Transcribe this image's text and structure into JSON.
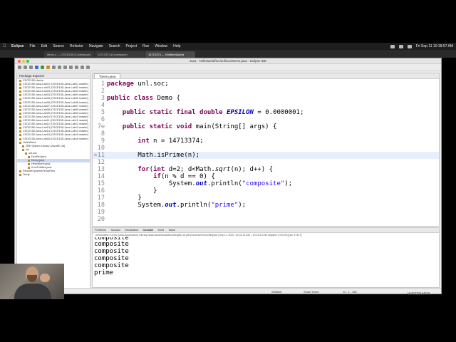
{
  "menubar": {
    "items": [
      "Eclipse",
      "File",
      "Edit",
      "Source",
      "Refactor",
      "Navigate",
      "Search",
      "Project",
      "Run",
      "Window",
      "Help"
    ],
    "clock": "Fri Sep 11 10:18:57 AM"
  },
  "browser_tabs": [
    "demo.c — CSCE155 (Codespace)",
    "14713374 (Codespace)",
    "14713374 — Wolfram|Alpha"
  ],
  "window": {
    "title": "Java - HelloWorld/src/unl/soc/Demo.java - Eclipse IDE"
  },
  "package_explorer": {
    "title": "Package Explorer",
    "items": [
      "CSCE155-Hacks",
      "CSCE155-Java-Lab01 [CSCE155-Java-Lab01 master]",
      "CSCE155-Java-Lab02 [CSCE155-Java-Lab02 master]",
      "CSCE155-Java-Lab03 [CSCE155-Java-Lab03 master]",
      "CSCE155-Java-Lab04 [CSCE155-Java-Lab04 master]",
      "CSCE155-Java-Lab05 [CSCE155-Java-Lab05 master]",
      "CSCE155-Java-Lab06 [CSCE155-Java-Lab06 master]",
      "CSCE155-Java-Lab07 [CSCE155-Java-Lab07 master]",
      "CSCE155-Java-Lab08 [CSCE155-Java-Lab08 master]",
      "CSCE155-Java-Lab09 [CSCE155-Java-Lab09 master]",
      "CSCE155-Java-Lab10 [CSCE155-Java-Lab10 master]",
      "CSCE155-Java-Lab11 [CSCE155-Java-Lab11 master]",
      "CSCE155-Java-Lab12 [CSCE155-Java-Lab12 master]",
      "CSCE155-Java-Lab13 [CSCE155-Java-Lab13 master]",
      "CSCE155-Java-Lab14 [CSCE155-Java-Lab14 master]",
      "CSCE155-Java-Lab15 [CSCE155-Java-Lab15 master]",
      "CSCE155-Java-Lab16 [CSCE155-Java-Lab16 master]",
      "HelloWorld",
      "JRE System Library [JavaSE-16]",
      "src",
      "unl.soc",
      "DecRef.java",
      "Demo.java",
      "HelloWorld.java",
      "KmsToMiles.java",
      "RemoteSystemsTempFiles",
      "Teisty"
    ],
    "selected_index": 22
  },
  "editor": {
    "tab": "*Demo.java",
    "lines": [
      {
        "n": "1",
        "tokens": [
          {
            "c": "kw",
            "t": "package"
          },
          {
            "c": "",
            "t": " unl.soc;"
          }
        ]
      },
      {
        "n": "2",
        "tokens": []
      },
      {
        "n": "3",
        "tokens": [
          {
            "c": "kw",
            "t": "public class"
          },
          {
            "c": "",
            "t": " Demo {"
          }
        ]
      },
      {
        "n": "4",
        "tokens": []
      },
      {
        "n": "5",
        "tokens": [
          {
            "c": "",
            "t": "    "
          },
          {
            "c": "kw",
            "t": "public static final double"
          },
          {
            "c": "",
            "t": " "
          },
          {
            "c": "sf",
            "t": "EPSILON"
          },
          {
            "c": "",
            "t": " = 0.0000001;"
          }
        ]
      },
      {
        "n": "6",
        "tokens": []
      },
      {
        "n": "7⊖",
        "tokens": [
          {
            "c": "",
            "t": "    "
          },
          {
            "c": "kw",
            "t": "public static void"
          },
          {
            "c": "",
            "t": " main(String[] args) {"
          }
        ]
      },
      {
        "n": "8",
        "tokens": []
      },
      {
        "n": "9",
        "tokens": [
          {
            "c": "",
            "t": "        "
          },
          {
            "c": "kw",
            "t": "int"
          },
          {
            "c": "",
            "t": " n = 14713374;"
          }
        ]
      },
      {
        "n": "10",
        "tokens": []
      },
      {
        "n": "»11",
        "tokens": [
          {
            "c": "",
            "t": "        Math."
          },
          {
            "c": "",
            "t": "isPrime"
          },
          {
            "c": "",
            "t": "(n);"
          }
        ],
        "hl": true
      },
      {
        "n": "12",
        "tokens": []
      },
      {
        "n": "13",
        "tokens": [
          {
            "c": "",
            "t": "        "
          },
          {
            "c": "kw",
            "t": "for"
          },
          {
            "c": "",
            "t": "("
          },
          {
            "c": "kw",
            "t": "int"
          },
          {
            "c": "",
            "t": " d=2; d<Math."
          },
          {
            "c": "st",
            "t": "sqrt"
          },
          {
            "c": "",
            "t": "(n); d++) {"
          }
        ]
      },
      {
        "n": "14",
        "tokens": [
          {
            "c": "",
            "t": "            "
          },
          {
            "c": "kw",
            "t": "if"
          },
          {
            "c": "",
            "t": "(n % d == 0) {"
          }
        ]
      },
      {
        "n": "15",
        "tokens": [
          {
            "c": "",
            "t": "                System."
          },
          {
            "c": "sf",
            "t": "out"
          },
          {
            "c": "",
            "t": ".println("
          },
          {
            "c": "str",
            "t": "\"composite\""
          },
          {
            "c": "",
            "t": ");"
          }
        ]
      },
      {
        "n": "16",
        "tokens": [
          {
            "c": "",
            "t": "            }"
          }
        ]
      },
      {
        "n": "17",
        "tokens": [
          {
            "c": "",
            "t": "        }"
          }
        ]
      },
      {
        "n": "18",
        "tokens": [
          {
            "c": "",
            "t": "        System."
          },
          {
            "c": "sf",
            "t": "out"
          },
          {
            "c": "",
            "t": ".println("
          },
          {
            "c": "str",
            "t": "\"prime\""
          },
          {
            "c": "",
            "t": ");"
          }
        ]
      },
      {
        "n": "19",
        "tokens": []
      },
      {
        "n": "20",
        "tokens": []
      }
    ]
  },
  "bottom_panel": {
    "tabs": [
      "Problems",
      "Javadoc",
      "Declaration",
      "Console",
      "JUnit",
      "Tasks"
    ],
    "active_tab": "Console",
    "info": "<terminated> Demo [Java Application] /Library/Java/JavaVirtualMachines/jdk-16.jdk/Contents/Home/bin/java (Sep 11, 2020, 10:18:10 AM – 10:18:10 AM elapsed: 0:00:00) [pid: 47417]",
    "output": [
      "composite",
      "composite",
      "composite",
      "composite",
      "composite",
      "prime"
    ]
  },
  "statusbar": {
    "writable": "Writable",
    "insert": "Smart Insert",
    "position": "11 : 1 : 160"
  },
  "watermark": "WATERMARK"
}
